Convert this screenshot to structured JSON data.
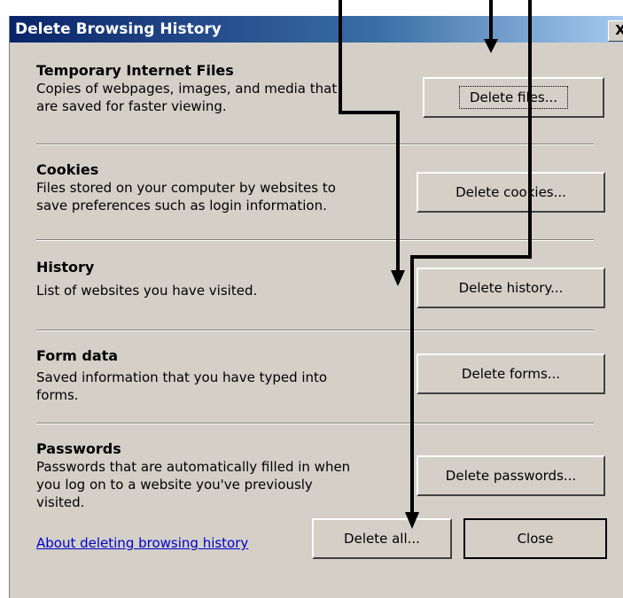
{
  "dialog": {
    "title": "Delete Browsing History",
    "close_glyph": "X"
  },
  "sections": [
    {
      "heading": "Temporary Internet Files",
      "desc_line1": "Copies of webpages, images, and media that",
      "desc_line2": "are saved for faster viewing.",
      "button": "Delete files..."
    },
    {
      "heading": "Cookies",
      "desc_line1": "Files stored on your computer by websites to",
      "desc_line2": "save preferences such as login information.",
      "button": "Delete cookies..."
    },
    {
      "heading": "History",
      "desc_line1": "List of websites you have visited.",
      "desc_line2": "",
      "button": "Delete history..."
    },
    {
      "heading": "Form data",
      "desc_line1": "Saved information that you have typed into",
      "desc_line2": "forms.",
      "button": "Delete forms..."
    },
    {
      "heading": "Passwords",
      "desc_line1": "Passwords that are automatically filled in when",
      "desc_line2": "you log on to a website you've previously",
      "desc_line3": "visited.",
      "button": "Delete passwords..."
    }
  ],
  "footer": {
    "link": "About deleting browsing history",
    "delete_all": "Delete all...",
    "close": "Close"
  }
}
